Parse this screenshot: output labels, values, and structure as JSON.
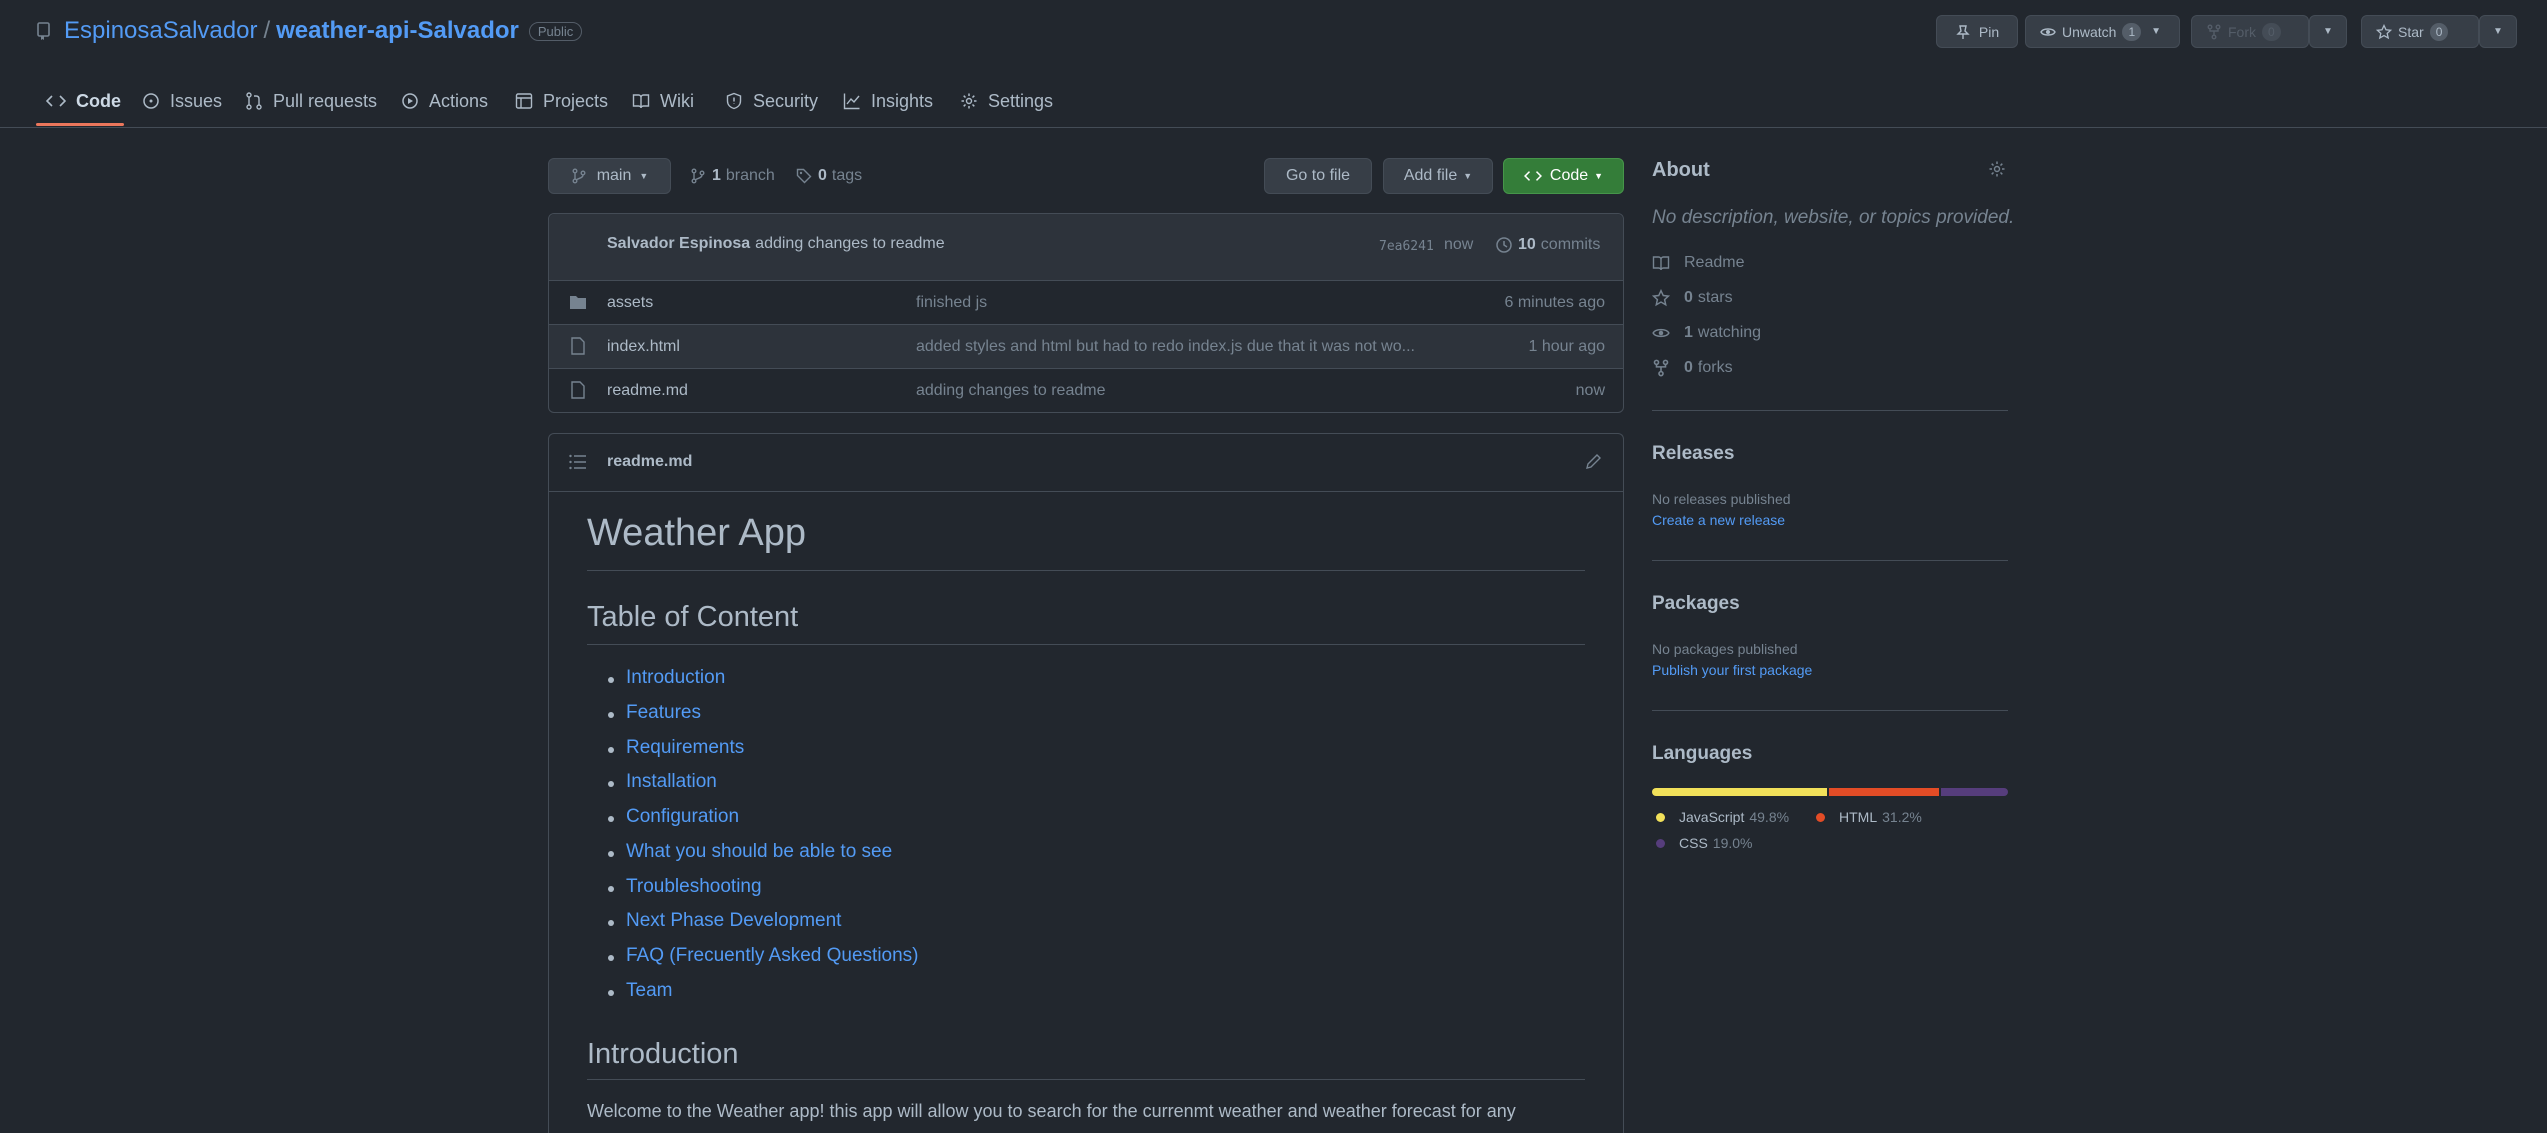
{
  "repo": {
    "owner": "EspinosaSalvador",
    "separator": "/",
    "name": "weather-api-Salvador",
    "visibility": "Public"
  },
  "header_buttons": {
    "pin": "Pin",
    "unwatch": "Unwatch",
    "unwatch_count": "1",
    "fork": "Fork",
    "fork_count": "0",
    "star": "Star",
    "star_count": "0"
  },
  "tabs": [
    {
      "label": "Code",
      "icon": "code-icon"
    },
    {
      "label": "Issues",
      "icon": "issue-opened-icon"
    },
    {
      "label": "Pull requests",
      "icon": "git-pull-request-icon"
    },
    {
      "label": "Actions",
      "icon": "play-icon"
    },
    {
      "label": "Projects",
      "icon": "table-icon"
    },
    {
      "label": "Wiki",
      "icon": "book-icon"
    },
    {
      "label": "Security",
      "icon": "shield-icon"
    },
    {
      "label": "Insights",
      "icon": "graph-icon"
    },
    {
      "label": "Settings",
      "icon": "gear-icon"
    }
  ],
  "toolbar": {
    "branch_selected": "main",
    "branch_count": "1",
    "branch_label": "branch",
    "tag_count": "0",
    "tag_label": "tags",
    "go_to_file": "Go to file",
    "add_file": "Add file",
    "code": "Code"
  },
  "commit": {
    "author": "Salvador Espinosa",
    "message": "adding changes to readme",
    "sha": "7ea6241",
    "time": "now",
    "count": "10",
    "count_label": "commits"
  },
  "files": [
    {
      "name": "assets",
      "type": "folder",
      "message": "finished js",
      "time": "6 minutes ago"
    },
    {
      "name": "index.html",
      "type": "file",
      "message": "added styles and html but had to redo index.js due that it was not wo...",
      "time": "1 hour ago"
    },
    {
      "name": "readme.md",
      "type": "file",
      "message": "adding changes to readme",
      "time": "now"
    }
  ],
  "readme": {
    "filename": "readme.md",
    "title": "Weather App",
    "toc_heading": "Table of Content",
    "toc": [
      "Introduction",
      "Features",
      "Requirements",
      "Installation",
      "Configuration",
      "What you should be able to see",
      "Troubleshooting",
      "Next Phase Development",
      "FAQ (Frecuently Asked Questions)",
      "Team"
    ],
    "intro_heading": "Introduction",
    "intro_text": "Welcome to the Weather app! this app will allow you to search for the currenmt weather and weather forecast for any"
  },
  "about": {
    "heading": "About",
    "description": "No description, website, or topics provided.",
    "readme": "Readme",
    "stars_count": "0",
    "stars_label": "stars",
    "watching_count": "1",
    "watching_label": "watching",
    "forks_count": "0",
    "forks_label": "forks"
  },
  "releases": {
    "heading": "Releases",
    "empty": "No releases published",
    "link": "Create a new release"
  },
  "packages": {
    "heading": "Packages",
    "empty": "No packages published",
    "link": "Publish your first package"
  },
  "languages": {
    "heading": "Languages",
    "items": [
      {
        "name": "JavaScript",
        "percent": "49.8%",
        "value": 49.8,
        "color": "#f1e05a"
      },
      {
        "name": "HTML",
        "percent": "31.2%",
        "value": 31.2,
        "color": "#e34c26"
      },
      {
        "name": "CSS",
        "percent": "19.0%",
        "value": 19.0,
        "color": "#563d7c"
      }
    ]
  },
  "colors": {
    "background": "#22272e",
    "accent_link": "#539bf5",
    "code_button": "#347d39",
    "tab_underline": "#ec775c"
  }
}
